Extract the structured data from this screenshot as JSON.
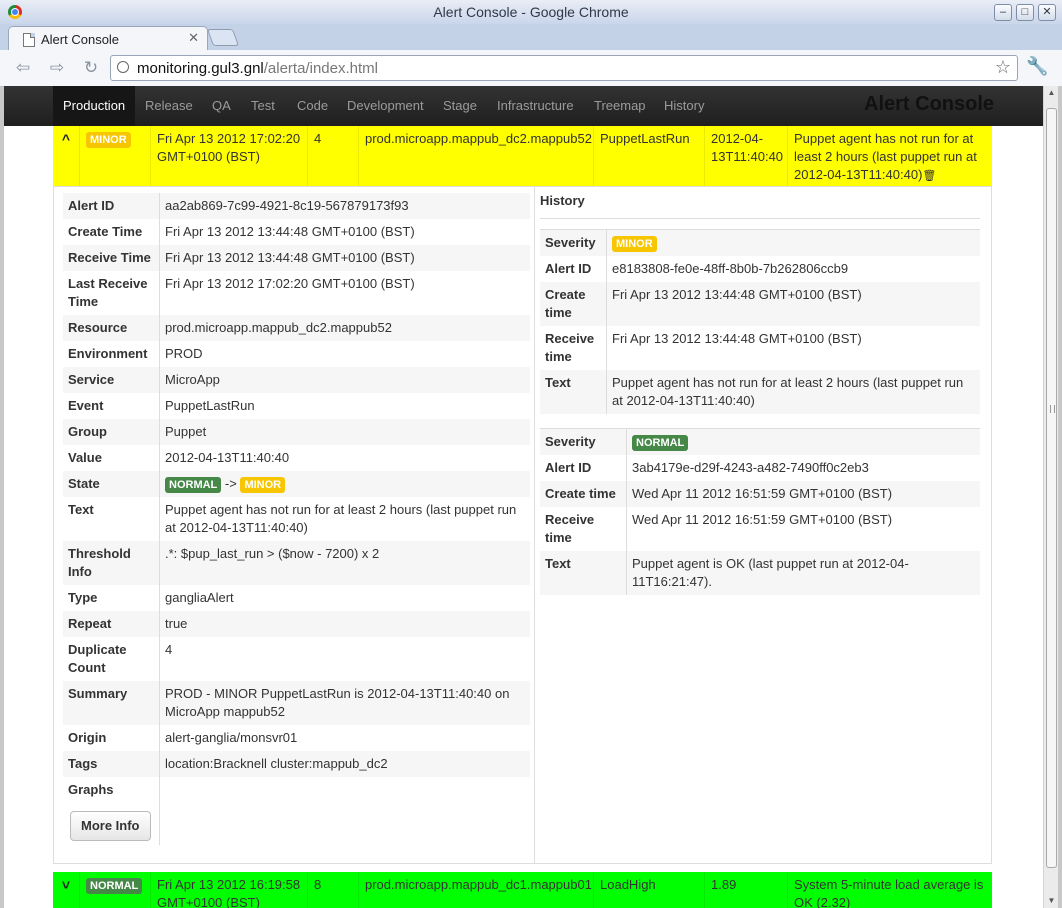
{
  "window": {
    "title": "Alert Console - Google Chrome",
    "minimize": "–",
    "maximize": "□",
    "close": "✕"
  },
  "tab": {
    "label": "Alert Console",
    "close": "✕"
  },
  "browser": {
    "back": "⇦",
    "forward": "⇨",
    "reload": "↻",
    "url_host": "monitoring.gul3.gnl",
    "url_path": "/alerta/index.html",
    "star": "☆",
    "wrench": "🔧"
  },
  "nav": {
    "items": [
      "Production",
      "Release",
      "QA",
      "Test",
      "Code",
      "Development",
      "Stage",
      "Infrastructure",
      "Treemap",
      "History"
    ],
    "active": "Production",
    "brand": "Alert Console"
  },
  "alert": {
    "expand_icon": "^",
    "severity": "MINOR",
    "last_receive": "Fri Apr 13 2012 17:02:20 GMT+0100 (BST)",
    "count": "4",
    "resource": "prod.microapp.mappub_dc2.mappub52",
    "event": "PuppetLastRun",
    "value": "2012-04-13T11:40:40",
    "text": "Puppet agent has not run for at least 2 hours (last puppet run at 2012-04-13T11:40:40)",
    "trash_icon": "🗑",
    "row_color": "#ffff00"
  },
  "details": [
    {
      "key": "Alert ID",
      "value": "aa2ab869-7c99-4921-8c19-567879173f93"
    },
    {
      "key": "Create Time",
      "value": "Fri Apr 13 2012 13:44:48 GMT+0100 (BST)"
    },
    {
      "key": "Receive Time",
      "value": "Fri Apr 13 2012 13:44:48 GMT+0100 (BST)"
    },
    {
      "key": "Last Receive Time",
      "value": "Fri Apr 13 2012 17:02:20 GMT+0100 (BST)"
    },
    {
      "key": "Resource",
      "value": "prod.microapp.mappub_dc2.mappub52"
    },
    {
      "key": "Environment",
      "value": "PROD"
    },
    {
      "key": "Service",
      "value": "MicroApp"
    },
    {
      "key": "Event",
      "value": "PuppetLastRun"
    },
    {
      "key": "Group",
      "value": "Puppet"
    },
    {
      "key": "Value",
      "value": "2012-04-13T11:40:40"
    },
    {
      "key": "State",
      "value": ""
    },
    {
      "key": "Text",
      "value": "Puppet agent has not run for at least 2 hours (last puppet run at 2012-04-13T11:40:40)"
    },
    {
      "key": "Threshold Info",
      "value": ".*: $pup_last_run > ($now - 7200) x 2"
    },
    {
      "key": "Type",
      "value": "gangliaAlert"
    },
    {
      "key": "Repeat",
      "value": "true"
    },
    {
      "key": "Duplicate Count",
      "value": "4"
    },
    {
      "key": "Summary",
      "value": "PROD - MINOR PuppetLastRun is 2012-04-13T11:40:40 on MicroApp mappub52"
    },
    {
      "key": "Origin",
      "value": "alert-ganglia/monsvr01"
    },
    {
      "key": "Tags",
      "value": "location:Bracknell cluster:mappub_dc2"
    },
    {
      "key": "Graphs",
      "value": ""
    }
  ],
  "state": {
    "from": "NORMAL",
    "arrow": "->",
    "to": "MINOR"
  },
  "more_info": "More Info",
  "history": {
    "title": "History",
    "entries": [
      {
        "severity": "MINOR",
        "severity_key": "Severity",
        "rows": [
          {
            "key": "Alert ID",
            "value": "e8183808-fe0e-48ff-8b0b-7b262806ccb9"
          },
          {
            "key": "Create time",
            "value": "Fri Apr 13 2012 13:44:48 GMT+0100 (BST)"
          },
          {
            "key": "Receive time",
            "value": "Fri Apr 13 2012 13:44:48 GMT+0100 (BST)"
          },
          {
            "key": "Text",
            "value": "Puppet agent has not run for at least 2 hours (last puppet run at 2012-04-13T11:40:40)"
          }
        ]
      },
      {
        "severity": "NORMAL",
        "severity_key": "Severity",
        "rows": [
          {
            "key": "Alert ID",
            "value": "3ab4179e-d29f-4243-a482-7490ff0c2eb3"
          },
          {
            "key": "Create time",
            "value": "Wed Apr 11 2012 16:51:59 GMT+0100 (BST)"
          },
          {
            "key": "Receive time",
            "value": "Wed Apr 11 2012 16:51:59 GMT+0100 (BST)"
          },
          {
            "key": "Text",
            "value": "Puppet agent is OK (last puppet run at 2012-04-11T16:21:47)."
          }
        ]
      }
    ]
  },
  "next_alert": {
    "expand_icon": "˅",
    "severity": "NORMAL",
    "last_receive": "Fri Apr 13 2012 16:19:58 GMT+0100 (BST)",
    "count": "8",
    "resource": "prod.microapp.mappub_dc1.mappub01",
    "event": "LoadHigh",
    "value": "1.89",
    "text": "System 5-minute load average is OK (2.32)",
    "row_color": "#00ff00"
  }
}
